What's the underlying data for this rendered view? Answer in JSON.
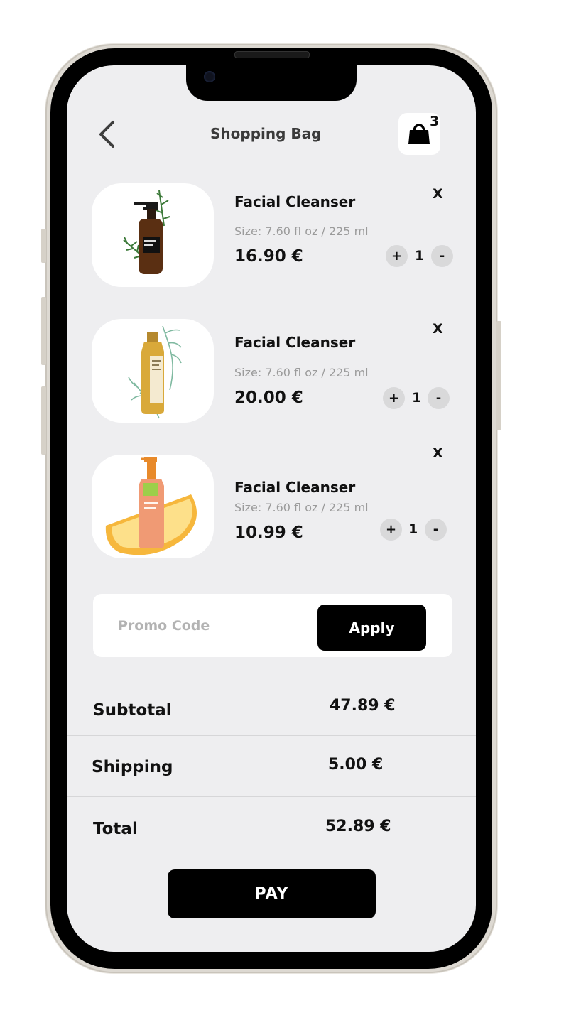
{
  "header": {
    "title": "Shopping Bag",
    "back_icon": "chevron-left-icon",
    "bag_icon": "shopping-bag-icon",
    "bag_count": "3"
  },
  "items": [
    {
      "name": "Facial Cleanser",
      "size": "Size: 7.60 fl oz / 225 ml",
      "price": "16.90 €",
      "quantity": "1",
      "remove_label": "X",
      "plus_label": "+",
      "minus_label": "-",
      "image": "amber-pump-bottle-with-rosemary"
    },
    {
      "name": "Facial Cleanser",
      "size": "Size: 7.60 fl oz / 225 ml",
      "price": "20.00 €",
      "quantity": "1",
      "remove_label": "X",
      "plus_label": "+",
      "minus_label": "-",
      "image": "golden-oil-bottle-with-leaves"
    },
    {
      "name": "Facial Cleanser",
      "size": "Size: 7.60 fl oz / 225 ml",
      "price": "10.99 €",
      "quantity": "1",
      "remove_label": "X",
      "plus_label": "+",
      "minus_label": "-",
      "image": "orange-gel-pump-bottle-with-orange-slice"
    }
  ],
  "promo": {
    "placeholder": "Promo Code",
    "value": "",
    "apply_label": "Apply"
  },
  "summary": {
    "subtotal_label": "Subtotal",
    "subtotal_value": "47.89 €",
    "shipping_label": "Shipping",
    "shipping_value": "5.00 €",
    "total_label": "Total",
    "total_value": "52.89 €"
  },
  "pay_label": "PAY",
  "colors": {
    "screen_background": "#eeeef0",
    "primary_button": "#000000",
    "card": "#ffffff",
    "muted_text": "#9b9b9b",
    "qty_button": "#d9d9da"
  }
}
